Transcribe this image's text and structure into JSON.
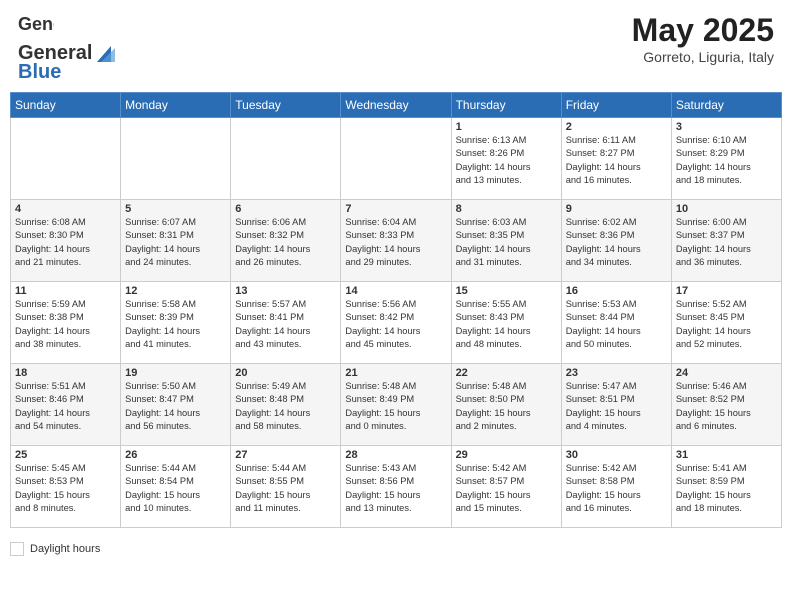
{
  "header": {
    "logo_general": "General",
    "logo_blue": "Blue",
    "month_title": "May 2025",
    "location": "Gorreto, Liguria, Italy"
  },
  "weekdays": [
    "Sunday",
    "Monday",
    "Tuesday",
    "Wednesday",
    "Thursday",
    "Friday",
    "Saturday"
  ],
  "legend": {
    "label": "Daylight hours"
  },
  "weeks": [
    [
      {
        "day": "",
        "info": ""
      },
      {
        "day": "",
        "info": ""
      },
      {
        "day": "",
        "info": ""
      },
      {
        "day": "",
        "info": ""
      },
      {
        "day": "1",
        "info": "Sunrise: 6:13 AM\nSunset: 8:26 PM\nDaylight: 14 hours\nand 13 minutes."
      },
      {
        "day": "2",
        "info": "Sunrise: 6:11 AM\nSunset: 8:27 PM\nDaylight: 14 hours\nand 16 minutes."
      },
      {
        "day": "3",
        "info": "Sunrise: 6:10 AM\nSunset: 8:29 PM\nDaylight: 14 hours\nand 18 minutes."
      }
    ],
    [
      {
        "day": "4",
        "info": "Sunrise: 6:08 AM\nSunset: 8:30 PM\nDaylight: 14 hours\nand 21 minutes."
      },
      {
        "day": "5",
        "info": "Sunrise: 6:07 AM\nSunset: 8:31 PM\nDaylight: 14 hours\nand 24 minutes."
      },
      {
        "day": "6",
        "info": "Sunrise: 6:06 AM\nSunset: 8:32 PM\nDaylight: 14 hours\nand 26 minutes."
      },
      {
        "day": "7",
        "info": "Sunrise: 6:04 AM\nSunset: 8:33 PM\nDaylight: 14 hours\nand 29 minutes."
      },
      {
        "day": "8",
        "info": "Sunrise: 6:03 AM\nSunset: 8:35 PM\nDaylight: 14 hours\nand 31 minutes."
      },
      {
        "day": "9",
        "info": "Sunrise: 6:02 AM\nSunset: 8:36 PM\nDaylight: 14 hours\nand 34 minutes."
      },
      {
        "day": "10",
        "info": "Sunrise: 6:00 AM\nSunset: 8:37 PM\nDaylight: 14 hours\nand 36 minutes."
      }
    ],
    [
      {
        "day": "11",
        "info": "Sunrise: 5:59 AM\nSunset: 8:38 PM\nDaylight: 14 hours\nand 38 minutes."
      },
      {
        "day": "12",
        "info": "Sunrise: 5:58 AM\nSunset: 8:39 PM\nDaylight: 14 hours\nand 41 minutes."
      },
      {
        "day": "13",
        "info": "Sunrise: 5:57 AM\nSunset: 8:41 PM\nDaylight: 14 hours\nand 43 minutes."
      },
      {
        "day": "14",
        "info": "Sunrise: 5:56 AM\nSunset: 8:42 PM\nDaylight: 14 hours\nand 45 minutes."
      },
      {
        "day": "15",
        "info": "Sunrise: 5:55 AM\nSunset: 8:43 PM\nDaylight: 14 hours\nand 48 minutes."
      },
      {
        "day": "16",
        "info": "Sunrise: 5:53 AM\nSunset: 8:44 PM\nDaylight: 14 hours\nand 50 minutes."
      },
      {
        "day": "17",
        "info": "Sunrise: 5:52 AM\nSunset: 8:45 PM\nDaylight: 14 hours\nand 52 minutes."
      }
    ],
    [
      {
        "day": "18",
        "info": "Sunrise: 5:51 AM\nSunset: 8:46 PM\nDaylight: 14 hours\nand 54 minutes."
      },
      {
        "day": "19",
        "info": "Sunrise: 5:50 AM\nSunset: 8:47 PM\nDaylight: 14 hours\nand 56 minutes."
      },
      {
        "day": "20",
        "info": "Sunrise: 5:49 AM\nSunset: 8:48 PM\nDaylight: 14 hours\nand 58 minutes."
      },
      {
        "day": "21",
        "info": "Sunrise: 5:48 AM\nSunset: 8:49 PM\nDaylight: 15 hours\nand 0 minutes."
      },
      {
        "day": "22",
        "info": "Sunrise: 5:48 AM\nSunset: 8:50 PM\nDaylight: 15 hours\nand 2 minutes."
      },
      {
        "day": "23",
        "info": "Sunrise: 5:47 AM\nSunset: 8:51 PM\nDaylight: 15 hours\nand 4 minutes."
      },
      {
        "day": "24",
        "info": "Sunrise: 5:46 AM\nSunset: 8:52 PM\nDaylight: 15 hours\nand 6 minutes."
      }
    ],
    [
      {
        "day": "25",
        "info": "Sunrise: 5:45 AM\nSunset: 8:53 PM\nDaylight: 15 hours\nand 8 minutes."
      },
      {
        "day": "26",
        "info": "Sunrise: 5:44 AM\nSunset: 8:54 PM\nDaylight: 15 hours\nand 10 minutes."
      },
      {
        "day": "27",
        "info": "Sunrise: 5:44 AM\nSunset: 8:55 PM\nDaylight: 15 hours\nand 11 minutes."
      },
      {
        "day": "28",
        "info": "Sunrise: 5:43 AM\nSunset: 8:56 PM\nDaylight: 15 hours\nand 13 minutes."
      },
      {
        "day": "29",
        "info": "Sunrise: 5:42 AM\nSunset: 8:57 PM\nDaylight: 15 hours\nand 15 minutes."
      },
      {
        "day": "30",
        "info": "Sunrise: 5:42 AM\nSunset: 8:58 PM\nDaylight: 15 hours\nand 16 minutes."
      },
      {
        "day": "31",
        "info": "Sunrise: 5:41 AM\nSunset: 8:59 PM\nDaylight: 15 hours\nand 18 minutes."
      }
    ]
  ]
}
